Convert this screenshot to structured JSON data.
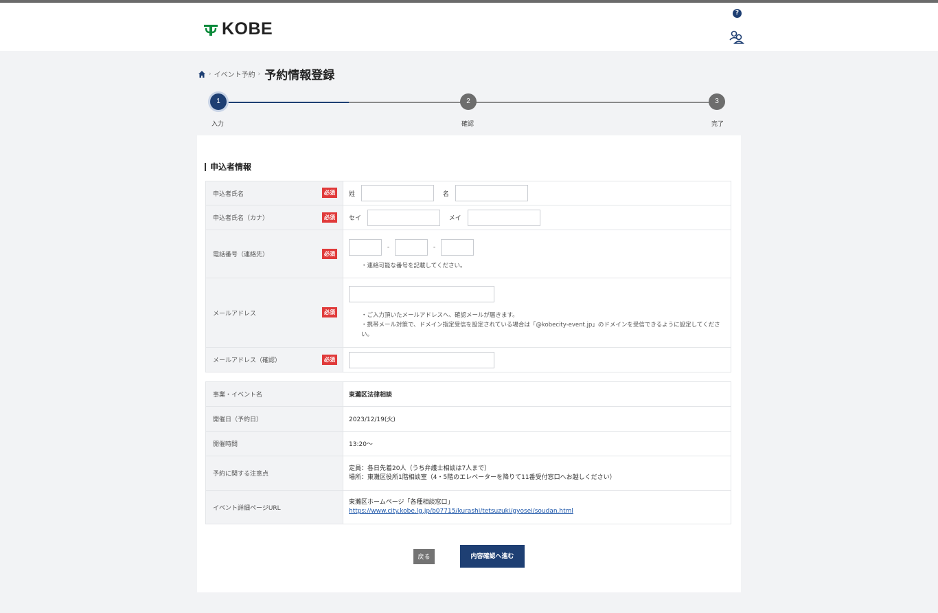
{
  "header": {
    "logo_text": "KOBE",
    "help_icon": "question-circle-icon",
    "user_icon": "people-icon"
  },
  "breadcrumb": {
    "home_icon": "home-icon",
    "separator": "›",
    "parent": "イベント予約",
    "current": "予約情報登録"
  },
  "steps": [
    {
      "number": "1",
      "label": "入力",
      "state": "active"
    },
    {
      "number": "2",
      "label": "確認",
      "state": "inactive"
    },
    {
      "number": "3",
      "label": "完了",
      "state": "inactive"
    }
  ],
  "colors": {
    "primary": "#1e3f73",
    "required": "#e03a3a",
    "inactive_step": "#6d6d6d",
    "background": "#f2f3f5"
  },
  "form": {
    "section_title": "申込者情報",
    "required_badge": "必須",
    "name": {
      "label": "申込者氏名",
      "last_label": "姓",
      "first_label": "名",
      "last_value": "",
      "first_value": ""
    },
    "kana": {
      "label": "申込者氏名（カナ）",
      "last_label": "セイ",
      "first_label": "メイ",
      "last_value": "",
      "first_value": ""
    },
    "phone": {
      "label": "電話番号（連絡先）",
      "separator": "-",
      "note": "・連絡可能な番号を記載してください。"
    },
    "email": {
      "label": "メールアドレス",
      "value": "",
      "note1": "・ご入力頂いたメールアドレスへ、確認メールが届きます。",
      "note2": "・携帯メール対策で、ドメイン指定受信を設定されている場合は「@kobecity-event.jp」のドメインを受信できるように設定してください。"
    },
    "email_confirm": {
      "label": "メールアドレス（確認）",
      "value": ""
    }
  },
  "event_info": {
    "name_label": "事業・イベント名",
    "name_value": "東灘区法律相談",
    "date_label": "開催日（予約日）",
    "date_value": "2023/12/19(火)",
    "time_label": "開催時間",
    "time_value": "13:20～",
    "notes_label": "予約に関する注意点",
    "notes_line1": "定員：各日先着20人（うち弁護士相談は7人まで）",
    "notes_line2": "場所：東灘区役所1階相談室（4・5階のエレベーターを降りて11番受付窓口へお越しください）",
    "url_label": "イベント詳細ページURL",
    "url_line1": "東灘区ホームページ「各種相談窓口」",
    "url_link": "https://www.city.kobe.lg.jp/b07715/kurashi/tetsuzuki/gyosei/soudan.html"
  },
  "buttons": {
    "back": "戻る",
    "next": "内容確認へ進む"
  }
}
